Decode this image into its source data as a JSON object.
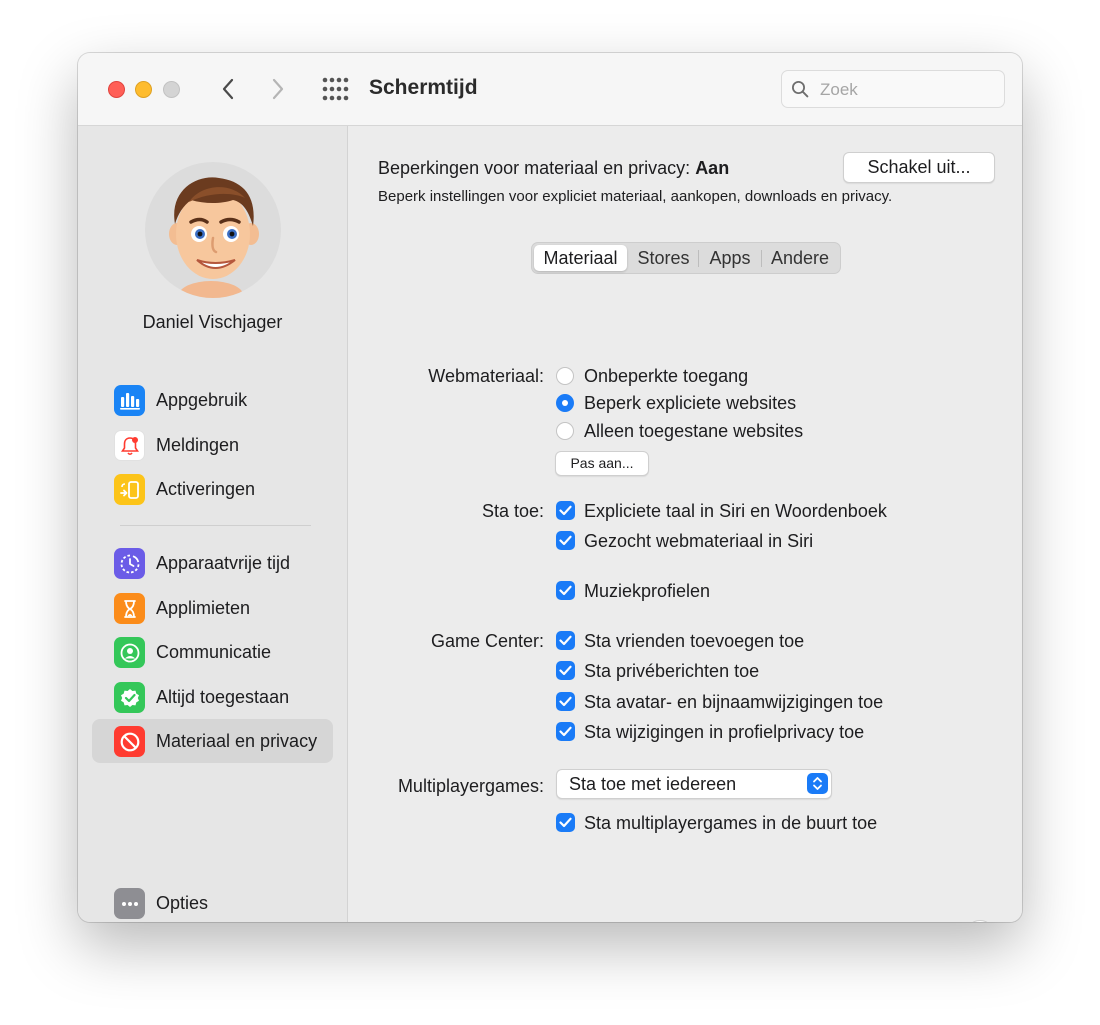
{
  "window": {
    "title": "Schermtijd"
  },
  "search": {
    "placeholder": "Zoek"
  },
  "user": {
    "name": "Daniel Vischjager"
  },
  "sidebar": {
    "items": [
      {
        "label": "Appgebruik",
        "icon": "bar-chart-icon",
        "color": "#1a84f5"
      },
      {
        "label": "Meldingen",
        "icon": "bell-icon",
        "color": "#ffffff"
      },
      {
        "label": "Activeringen",
        "icon": "phone-arrow-icon",
        "color": "#fcc419"
      },
      {
        "label": "Apparaatvrije tijd",
        "icon": "downtime-icon",
        "color": "#6b5ce7"
      },
      {
        "label": "Applimieten",
        "icon": "hourglass-icon",
        "color": "#fb8c1a"
      },
      {
        "label": "Communicatie",
        "icon": "person-circle-icon",
        "color": "#34c759"
      },
      {
        "label": "Altijd toegestaan",
        "icon": "check-badge-icon",
        "color": "#34c759"
      },
      {
        "label": "Materiaal en privacy",
        "icon": "no-entry-icon",
        "color": "#ff3b30"
      }
    ],
    "options": {
      "label": "Opties",
      "icon": "ellipsis-icon",
      "color": "#8e8e93"
    },
    "selected_index": 7
  },
  "status": {
    "label": "Beperkingen voor materiaal en privacy:",
    "value": "Aan",
    "description": "Beperk instellingen voor expliciet materiaal, aankopen, downloads en privacy.",
    "button": "Schakel uit..."
  },
  "tabs": [
    {
      "label": "Materiaal",
      "active": true
    },
    {
      "label": "Stores",
      "active": false
    },
    {
      "label": "Apps",
      "active": false
    },
    {
      "label": "Andere",
      "active": false
    }
  ],
  "web": {
    "label": "Webmateriaal:",
    "options": [
      {
        "label": "Onbeperkte toegang",
        "selected": false
      },
      {
        "label": "Beperk expliciete websites",
        "selected": true
      },
      {
        "label": "Alleen toegestane websites",
        "selected": false
      }
    ],
    "button": "Pas aan..."
  },
  "allow": {
    "label": "Sta toe:",
    "options": [
      {
        "label": "Expliciete taal in Siri en Woordenboek",
        "checked": true
      },
      {
        "label": "Gezocht webmateriaal in Siri",
        "checked": true
      },
      {
        "label": "Muziekprofielen",
        "checked": true
      }
    ]
  },
  "game_center": {
    "label": "Game Center:",
    "options": [
      {
        "label": "Sta vrienden toevoegen toe",
        "checked": true
      },
      {
        "label": "Sta privéberichten toe",
        "checked": true
      },
      {
        "label": "Sta avatar- en bijnaamwijzigingen toe",
        "checked": true
      },
      {
        "label": "Sta wijzigingen in profielprivacy toe",
        "checked": true
      }
    ]
  },
  "multiplayer": {
    "label": "Multiplayergames:",
    "selected": "Sta toe met iedereen",
    "nearby": {
      "label": "Sta multiplayergames in de buurt toe",
      "checked": true
    }
  },
  "help": {
    "label": "?"
  },
  "colors": {
    "accent": "#1a7bf7",
    "selected_bg": "#d6d6d6"
  }
}
